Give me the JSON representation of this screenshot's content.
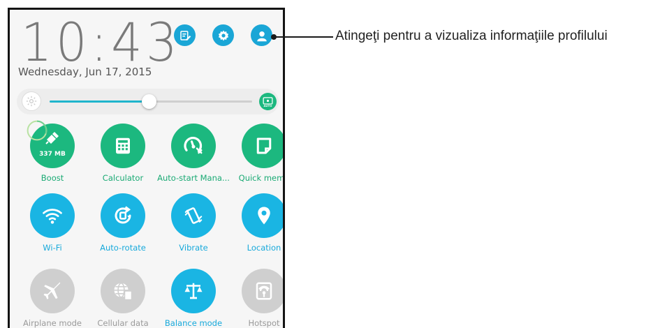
{
  "status": {
    "time": "10:43",
    "date": "Wednesday, Jun 17, 2015"
  },
  "header_buttons": [
    {
      "name": "edit-icon",
      "color": "#1aa6d6"
    },
    {
      "name": "gear-icon",
      "color": "#1aa6d6"
    },
    {
      "name": "profile-icon",
      "color": "#1aa6d6"
    }
  ],
  "brightness": {
    "level_percent": 49,
    "auto_label": "AUTO"
  },
  "colors": {
    "green": "#1cb87f",
    "blue": "#1ab5e3",
    "gray": "#cfcfcf",
    "label_green": "#1aaa74",
    "label_blue": "#17a9db",
    "label_gray": "#9a9a9a"
  },
  "boost": {
    "memory": "337 MB"
  },
  "tiles": [
    {
      "label": "Boost",
      "icon": "broom-icon",
      "state": "green"
    },
    {
      "label": "Calculator",
      "icon": "calculator-icon",
      "state": "green"
    },
    {
      "label": "Auto-start Mana...",
      "icon": "gauge-icon",
      "state": "green"
    },
    {
      "label": "Quick memo",
      "icon": "memo-icon",
      "state": "green"
    },
    {
      "label": "Wi-Fi",
      "icon": "wifi-icon",
      "state": "blue"
    },
    {
      "label": "Auto-rotate",
      "icon": "rotate-icon",
      "state": "blue"
    },
    {
      "label": "Vibrate",
      "icon": "vibrate-icon",
      "state": "blue"
    },
    {
      "label": "Location",
      "icon": "location-pin-icon",
      "state": "blue"
    },
    {
      "label": "Airplane mode",
      "icon": "airplane-icon",
      "state": "gray"
    },
    {
      "label": "Cellular data",
      "icon": "cellular-data-icon",
      "state": "gray"
    },
    {
      "label": "Balance mode",
      "icon": "balance-scale-icon",
      "state": "blue"
    },
    {
      "label": "Hotspot",
      "icon": "hotspot-icon",
      "state": "gray"
    }
  ],
  "callout": {
    "text": "Atingeţi pentru a vizualiza informaţiile profilului"
  }
}
